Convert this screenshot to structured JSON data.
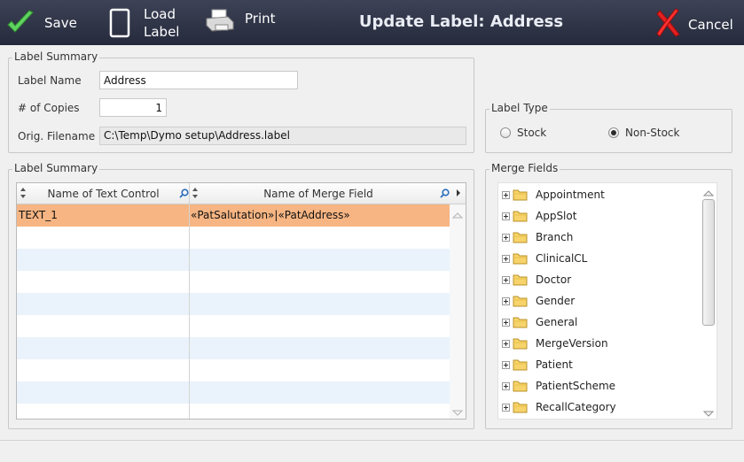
{
  "toolbar": {
    "save_label": "Save",
    "load_label_line1": "Load",
    "load_label_line2": "Label",
    "print_label": "Print",
    "title": "Update Label: Address",
    "cancel_label": "Cancel",
    "icons": {
      "save": "checkmark-icon",
      "load": "document-icon",
      "print": "printer-icon",
      "cancel": "red-x-icon"
    }
  },
  "label_summary": {
    "legend": "Label Summary",
    "name_label": "Label Name",
    "name_value": "Address",
    "copies_label": "# of Copies",
    "copies_value": "1",
    "filename_label": "Orig. Filename",
    "filename_value": "C:\\Temp\\Dymo setup\\Address.label"
  },
  "label_type": {
    "legend": "Label Type",
    "options": [
      {
        "label": "Stock",
        "selected": false
      },
      {
        "label": "Non-Stock",
        "selected": true
      }
    ]
  },
  "controls_grid": {
    "legend": "Label Summary",
    "columns": [
      "Name of Text Control",
      "Name of Merge Field"
    ],
    "rows": [
      {
        "control": "TEXT_1",
        "merge_field": "«PatSalutation»|«PatAddress»",
        "selected": true
      }
    ],
    "selected_color": "#f6b583",
    "alt_row_color": "#eaf3fb"
  },
  "merge_fields": {
    "legend": "Merge Fields",
    "items": [
      "Appointment",
      "AppSlot",
      "Branch",
      "ClinicalCL",
      "Doctor",
      "Gender",
      "General",
      "MergeVersion",
      "Patient",
      "PatientScheme",
      "RecallCategory"
    ]
  }
}
